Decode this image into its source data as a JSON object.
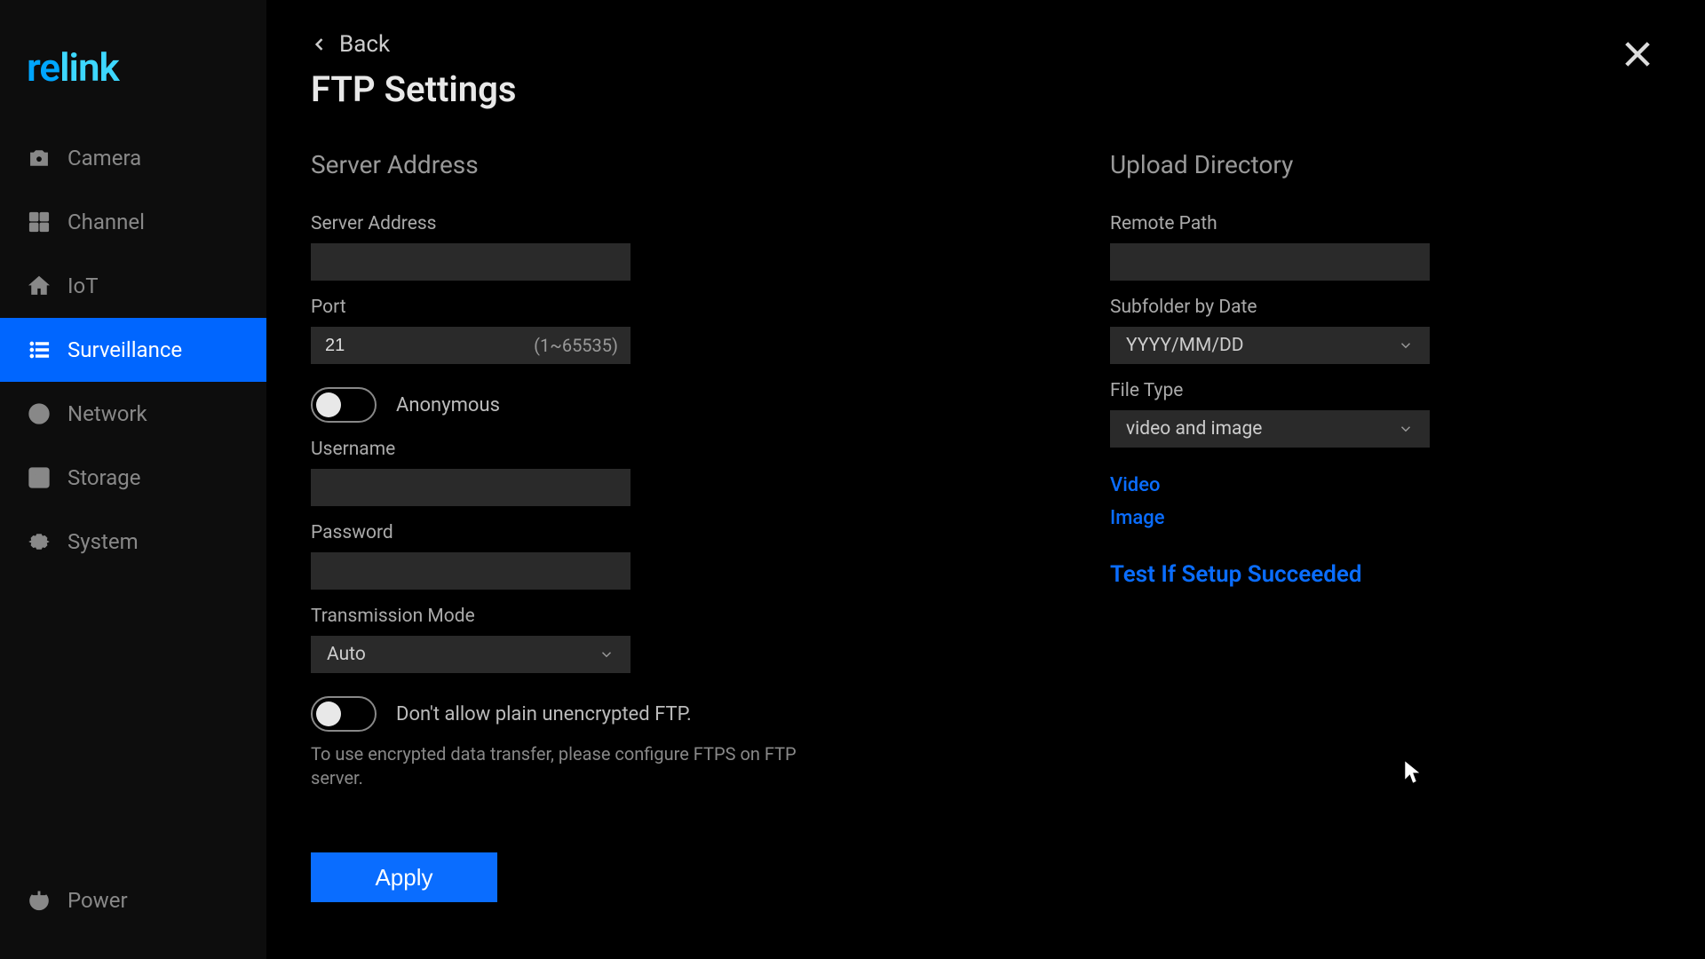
{
  "brand": {
    "left": "re",
    "right": "link"
  },
  "sidebar": {
    "items": [
      {
        "label": "Camera"
      },
      {
        "label": "Channel"
      },
      {
        "label": "IoT"
      },
      {
        "label": "Surveillance"
      },
      {
        "label": "Network"
      },
      {
        "label": "Storage"
      },
      {
        "label": "System"
      }
    ],
    "power": "Power"
  },
  "header": {
    "back": "Back",
    "title": "FTP Settings"
  },
  "left": {
    "section": "Server Address",
    "server_address_label": "Server Address",
    "server_address_value": "",
    "port_label": "Port",
    "port_value": "21",
    "port_hint": "(1~65535)",
    "anonymous_label": "Anonymous",
    "username_label": "Username",
    "username_value": "",
    "password_label": "Password",
    "password_value": "",
    "transmission_label": "Transmission Mode",
    "transmission_value": "Auto",
    "no_plain_label": "Don't allow plain unencrypted FTP.",
    "help": "To use encrypted data transfer, please configure FTPS on FTP server."
  },
  "right": {
    "section": "Upload Directory",
    "remote_path_label": "Remote Path",
    "remote_path_value": "",
    "subfolder_label": "Subfolder by Date",
    "subfolder_value": "YYYY/MM/DD",
    "filetype_label": "File Type",
    "filetype_value": "video and image",
    "video_link": "Video",
    "image_link": "Image",
    "test_link": "Test If Setup Succeeded"
  },
  "apply": "Apply"
}
